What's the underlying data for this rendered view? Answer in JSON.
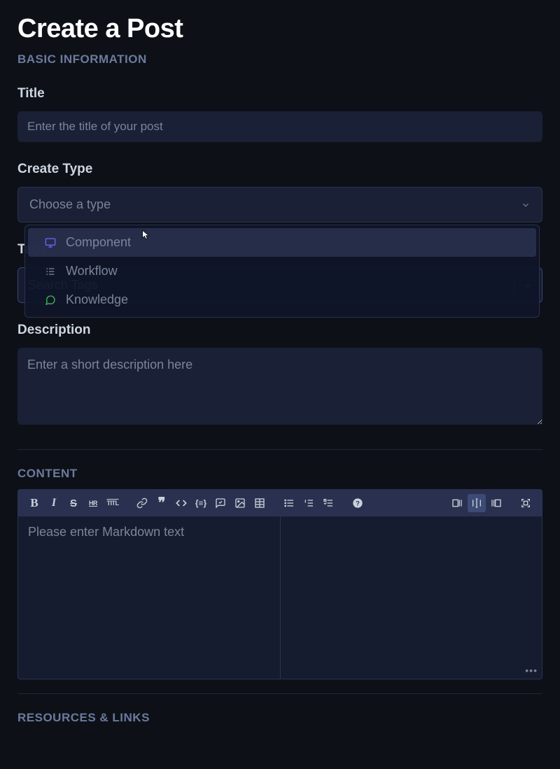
{
  "page": {
    "title": "Create a Post"
  },
  "sections": {
    "basic": "BASIC INFORMATION",
    "content": "CONTENT",
    "resources": "RESOURCES & LINKS"
  },
  "fields": {
    "title": {
      "label": "Title",
      "placeholder": "Enter the title of your post",
      "value": ""
    },
    "createType": {
      "label": "Create Type",
      "placeholder": "Choose a type",
      "value": ""
    },
    "tags": {
      "label": "Tags",
      "placeholder": "Search Tags",
      "value": ""
    },
    "description": {
      "label": "Description",
      "placeholder": "Enter a short description here",
      "value": ""
    }
  },
  "typeOptions": [
    {
      "id": "component",
      "label": "Component",
      "icon": "monitor",
      "iconColor": "#6b63ff"
    },
    {
      "id": "workflow",
      "label": "Workflow",
      "icon": "list",
      "iconColor": "#7a8599"
    },
    {
      "id": "knowledge",
      "label": "Knowledge",
      "icon": "chat",
      "iconColor": "#3fb950"
    }
  ],
  "editor": {
    "placeholder": "Please enter Markdown text",
    "toolbar": {
      "format": [
        "bold",
        "italic",
        "strike",
        "hr",
        "title"
      ],
      "insert": [
        "link",
        "quote",
        "code",
        "codeblock",
        "comment",
        "image",
        "table"
      ],
      "lists": [
        "ul",
        "ol",
        "task"
      ],
      "help": [
        "help"
      ],
      "view": [
        "write",
        "split",
        "preview",
        "fullscreen"
      ],
      "activeView": "split"
    }
  }
}
